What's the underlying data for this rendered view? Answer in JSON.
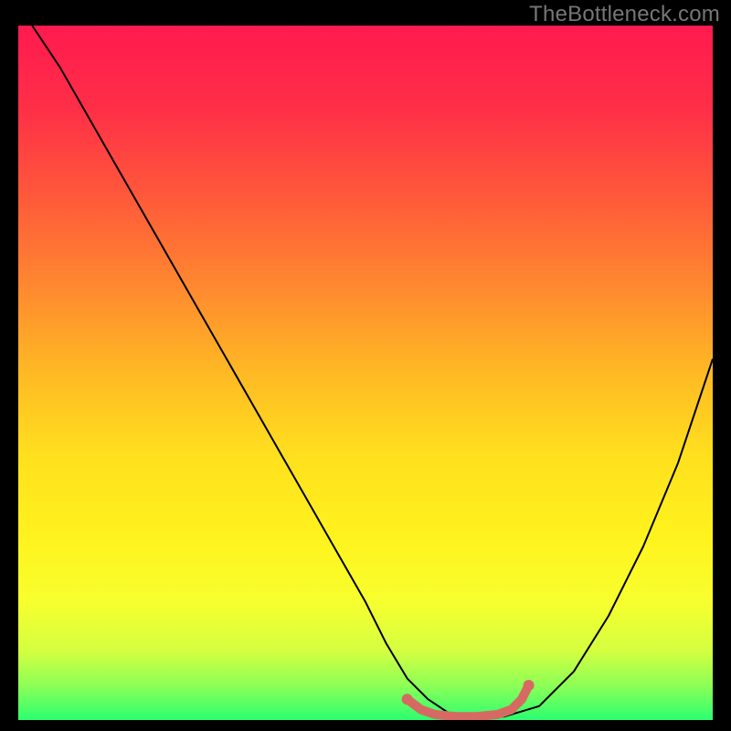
{
  "watermark": "TheBottleneck.com",
  "gradient": {
    "stops": [
      {
        "offset": 0.0,
        "color": "#ff1a4f"
      },
      {
        "offset": 0.12,
        "color": "#ff2f47"
      },
      {
        "offset": 0.25,
        "color": "#ff5a3a"
      },
      {
        "offset": 0.38,
        "color": "#ff8a2f"
      },
      {
        "offset": 0.5,
        "color": "#ffb924"
      },
      {
        "offset": 0.62,
        "color": "#ffe01e"
      },
      {
        "offset": 0.74,
        "color": "#fff31e"
      },
      {
        "offset": 0.83,
        "color": "#f7ff2e"
      },
      {
        "offset": 0.9,
        "color": "#d4ff40"
      },
      {
        "offset": 0.95,
        "color": "#8dff56"
      },
      {
        "offset": 1.0,
        "color": "#2cff70"
      }
    ]
  },
  "chart_data": {
    "type": "line",
    "title": "",
    "xlabel": "",
    "ylabel": "",
    "xlim": [
      0,
      100
    ],
    "ylim": [
      0,
      100
    ],
    "series": [
      {
        "name": "bottleneck-curve",
        "stroke": "#000000",
        "stroke_width": 2,
        "x": [
          2,
          6,
          10,
          14,
          18,
          22,
          26,
          30,
          34,
          38,
          42,
          46,
          50,
          53,
          56,
          59,
          62,
          65,
          70,
          75,
          80,
          85,
          90,
          95,
          100
        ],
        "y": [
          100,
          94,
          87,
          80,
          73,
          66,
          59,
          52,
          45,
          38,
          31,
          24,
          17,
          11,
          6,
          3,
          1,
          0.5,
          0.5,
          2,
          7,
          15,
          25,
          37,
          52
        ]
      },
      {
        "name": "highlight-band",
        "stroke": "#d66a63",
        "stroke_width": 10,
        "linecap": "round",
        "x": [
          56,
          58,
          60,
          63,
          66,
          69,
          71,
          72.5,
          73.5
        ],
        "y": [
          3.0,
          1.5,
          0.8,
          0.5,
          0.5,
          0.8,
          1.5,
          3.0,
          5.0
        ]
      }
    ],
    "markers": [
      {
        "name": "highlight-dot-left",
        "x": 56,
        "y": 3.0,
        "r": 6,
        "color": "#d66a63"
      },
      {
        "name": "highlight-dot-right",
        "x": 73.5,
        "y": 5.0,
        "r": 6,
        "color": "#d66a63"
      }
    ]
  }
}
